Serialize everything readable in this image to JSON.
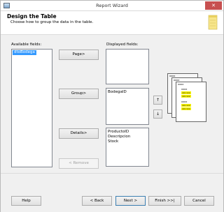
{
  "window": {
    "title": "Report Wizard",
    "close_glyph": "✕"
  },
  "header": {
    "title": "Design the Table",
    "subtitle": "Choose how to group the data in the table."
  },
  "available": {
    "label": "Available fields:",
    "items": [
      "dtoBodega"
    ]
  },
  "displayed": {
    "label": "Displayed fields:"
  },
  "buttons": {
    "page": "Page>",
    "group": "Group>",
    "details": "Details>",
    "remove": "< Remove",
    "up_glyph": "↑",
    "down_glyph": "↓"
  },
  "page_list": {
    "items": []
  },
  "group_list": {
    "items": [
      "BodegaID"
    ]
  },
  "details_list": {
    "items": [
      "ProductoID",
      "Descripcion",
      "Stock"
    ]
  },
  "preview": {
    "header_text": "xxxx",
    "rows": [
      "xxx xxx",
      "xxx xxx"
    ]
  },
  "footer": {
    "help": "Help",
    "back": "< Back",
    "next": "Next >",
    "finish": "Finish >>|",
    "cancel": "Cancel"
  },
  "colors": {
    "selection": "#3399ff",
    "highlight": "#f7f200",
    "close": "#c75050"
  }
}
